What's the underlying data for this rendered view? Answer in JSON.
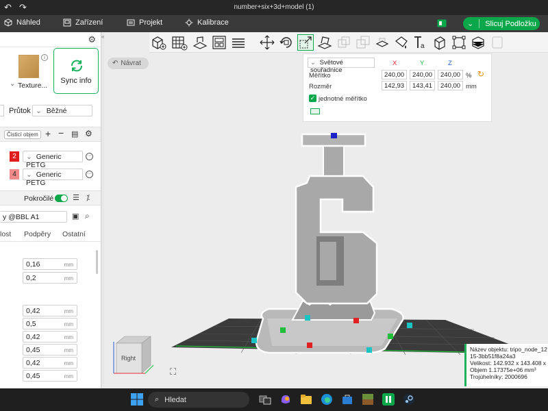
{
  "window": {
    "title": "number+six+3d+model (1)"
  },
  "menu": {
    "items": [
      {
        "label": "Náhled",
        "icon": "cube-icon"
      },
      {
        "label": "Zařízení",
        "icon": "device-icon"
      },
      {
        "label": "Projekt",
        "icon": "project-icon"
      },
      {
        "label": "Kalibrace",
        "icon": "calibration-icon"
      }
    ],
    "slice_label": "Slicuj Podložku"
  },
  "left_panel": {
    "texture_label": "Texture...",
    "sync_label": "Sync info",
    "flow_label": "Průtok",
    "flow_value": "Běžné",
    "purge_label": "Čisticí objem",
    "filaments": [
      {
        "index": "2",
        "name": "Generic PETG",
        "color": "#e01c1c"
      },
      {
        "index": "4",
        "name": "Generic PETG",
        "color": "#f08a8a"
      }
    ],
    "advanced_label": "Pokročilé",
    "process_name": "y @BBL A1",
    "tabs": [
      "lost",
      "Podpěry",
      "Ostatní"
    ],
    "values_a": [
      {
        "value": "0,16",
        "unit": "mm"
      },
      {
        "value": "0,2",
        "unit": "mm"
      }
    ],
    "values_b": [
      {
        "value": "0,42",
        "unit": "mm"
      },
      {
        "value": "0,5",
        "unit": "mm"
      },
      {
        "value": "0,42",
        "unit": "mm"
      },
      {
        "value": "0,45",
        "unit": "mm"
      },
      {
        "value": "0,42",
        "unit": "mm"
      },
      {
        "value": "0,45",
        "unit": "mm"
      }
    ]
  },
  "viewport": {
    "back_label": "Návrat",
    "coord_system": "Světové souřadnice",
    "axes": [
      "X",
      "Y",
      "Z"
    ],
    "scale": {
      "label": "Měřítko",
      "x": "240,00",
      "y": "240,00",
      "z": "240,00",
      "unit": "%"
    },
    "size": {
      "label": "Rozměr",
      "x": "142,93",
      "y": "143,41",
      "z": "240,00",
      "unit": "mm"
    },
    "uniform_label": "jednotné měřítko",
    "cube_label": "Right",
    "object_info": {
      "name": "Název objektu: tripo_node_12",
      "id": "15-3bb51f8a24a3",
      "size": "Velikost: 142.932 x 143.408 x",
      "volume": "Objem 1.17375e+06 mm³",
      "triangles": "Trojúhelníky: 2000696"
    }
  },
  "taskbar": {
    "search_label": "Hledat"
  },
  "colors": {
    "accent": "#0aa84a",
    "panel": "#ffffff",
    "viewport": "#ececec"
  }
}
